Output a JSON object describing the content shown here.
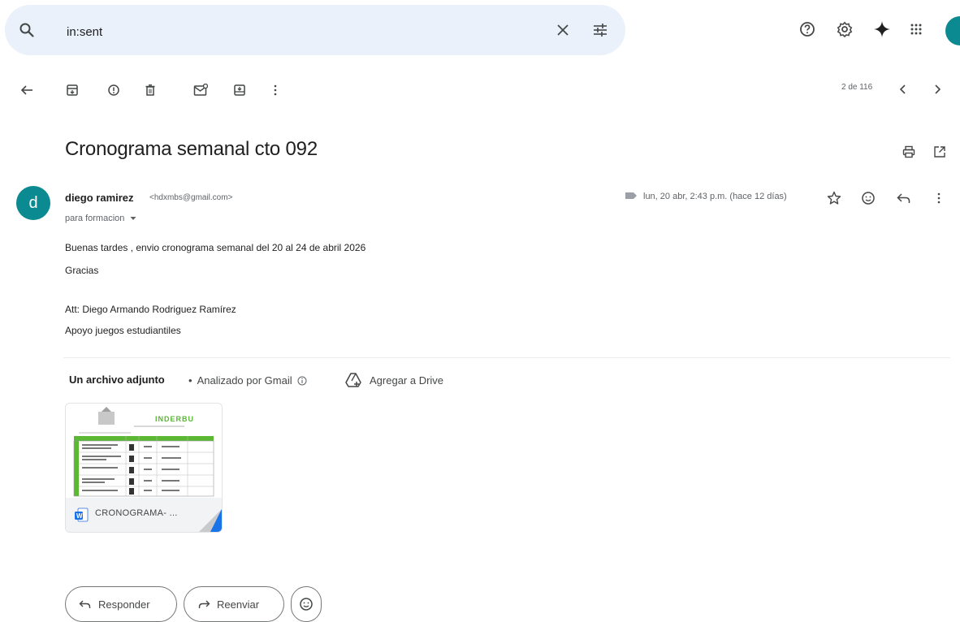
{
  "search": {
    "query": "in:sent"
  },
  "toolbar": {
    "page_count": "2 de 116"
  },
  "email": {
    "subject": "Cronograma semanal cto 092",
    "sender_initial": "d",
    "sender_name": "diego ramirez",
    "sender_email": "<hdxmbs@gmail.com>",
    "recipient": "para formacion",
    "date": "lun, 20 abr, 2:43 p.m. (hace 12 días)",
    "body_lines": [
      "Buenas tardes , envio cronograma semanal del 20 al 24 de abril 2026",
      "Gracias",
      "Att: Diego Armando Rodriguez Ramírez",
      "Apoyo juegos estudiantiles"
    ]
  },
  "attachments": {
    "title": "Un archivo adjunto",
    "separator": "•",
    "analyzed": "Analizado por Gmail",
    "add_to_drive": "Agregar a Drive",
    "file_name": "CRONOGRAMA- ...",
    "preview_heading": "INDERBU"
  },
  "actions": {
    "reply": "Responder",
    "forward": "Reenviar"
  },
  "colors": {
    "search_bg": "#eaf1fb",
    "avatar_bg": "#0b8a91",
    "preview_green": "#5ab833",
    "word_blue": "#1a73e8"
  }
}
